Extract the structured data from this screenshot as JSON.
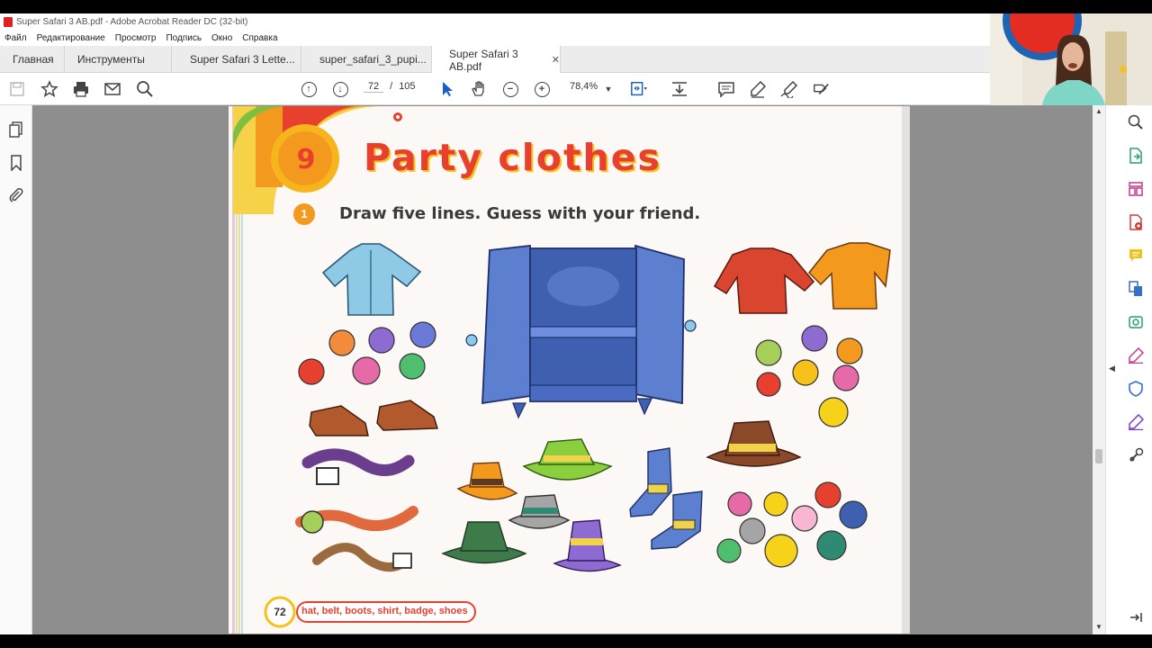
{
  "window": {
    "title": "Super Safari 3 AB.pdf - Adobe Acrobat Reader DC (32-bit)"
  },
  "menu": [
    "Файл",
    "Редактирование",
    "Просмотр",
    "Подпись",
    "Окно",
    "Справка"
  ],
  "tabs": [
    {
      "label": "Главная"
    },
    {
      "label": "Инструменты"
    },
    {
      "label": "Super Safari 3 Lette..."
    },
    {
      "label": "super_safari_3_pupi..."
    },
    {
      "label": "Super Safari 3 AB.pdf",
      "active": true,
      "close": "✕"
    }
  ],
  "toolbar": {
    "page_current": "72",
    "page_sep": "/",
    "page_total": "105",
    "zoom": "78,4%"
  },
  "document": {
    "unit_number": "9",
    "title": "Party clothes",
    "exercise_number": "1",
    "instruction": "Draw five lines. Guess with your friend.",
    "page_number": "72",
    "footer_words": "hat, belt, boots, shirt, badge, shoes"
  },
  "colors": {
    "accent_red": "#e8402f",
    "badge_orange": "#f39a1e",
    "wardrobe_blue": "#5c7fcf"
  },
  "icons": {
    "left_rail": [
      "pages-icon",
      "bookmark-icon",
      "attachment-icon"
    ],
    "right_rail": [
      "zoom-icon",
      "export-pdf-icon",
      "organize-pages-icon",
      "create-pdf-icon",
      "comment-icon",
      "combine-files-icon",
      "scan-icon",
      "fill-sign-icon",
      "protect-icon",
      "edit-pen-icon",
      "more-tools-icon",
      "collapse-panel-icon"
    ]
  }
}
